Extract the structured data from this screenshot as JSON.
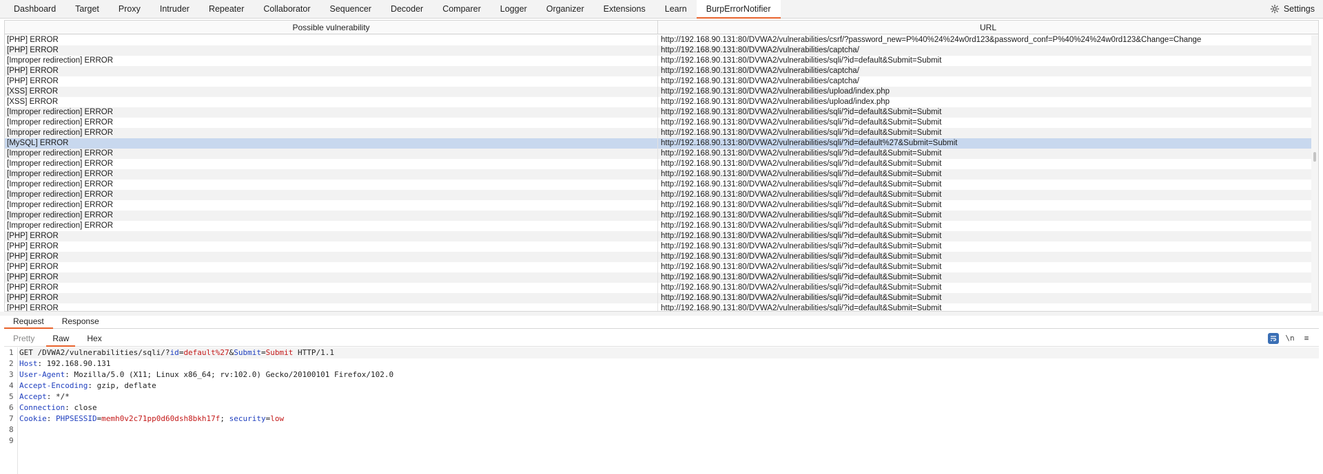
{
  "top_tabs": [
    "Dashboard",
    "Target",
    "Proxy",
    "Intruder",
    "Repeater",
    "Collaborator",
    "Sequencer",
    "Decoder",
    "Comparer",
    "Logger",
    "Organizer",
    "Extensions",
    "Learn",
    "BurpErrorNotifier"
  ],
  "active_top_tab": "BurpErrorNotifier",
  "settings_label": "Settings",
  "table": {
    "headers": [
      "Possible vulnerability",
      "URL"
    ],
    "selected_row_index": 10,
    "rows": [
      [
        "[PHP] ERROR",
        "http://192.168.90.131:80/DVWA2/vulnerabilities/csrf/?password_new=P%40%24%24w0rd123&password_conf=P%40%24%24w0rd123&Change=Change"
      ],
      [
        "[PHP] ERROR",
        "http://192.168.90.131:80/DVWA2/vulnerabilities/captcha/"
      ],
      [
        "[Improper redirection] ERROR",
        "http://192.168.90.131:80/DVWA2/vulnerabilities/sqli/?id=default&Submit=Submit"
      ],
      [
        "[PHP] ERROR",
        "http://192.168.90.131:80/DVWA2/vulnerabilities/captcha/"
      ],
      [
        "[PHP] ERROR",
        "http://192.168.90.131:80/DVWA2/vulnerabilities/captcha/"
      ],
      [
        "[XSS] ERROR",
        "http://192.168.90.131:80/DVWA2/vulnerabilities/upload/index.php"
      ],
      [
        "[XSS] ERROR",
        "http://192.168.90.131:80/DVWA2/vulnerabilities/upload/index.php"
      ],
      [
        "[Improper redirection] ERROR",
        "http://192.168.90.131:80/DVWA2/vulnerabilities/sqli/?id=default&Submit=Submit"
      ],
      [
        "[Improper redirection] ERROR",
        "http://192.168.90.131:80/DVWA2/vulnerabilities/sqli/?id=default&Submit=Submit"
      ],
      [
        "[Improper redirection] ERROR",
        "http://192.168.90.131:80/DVWA2/vulnerabilities/sqli/?id=default&Submit=Submit"
      ],
      [
        "[MySQL] ERROR",
        "http://192.168.90.131:80/DVWA2/vulnerabilities/sqli/?id=default%27&Submit=Submit"
      ],
      [
        "[Improper redirection] ERROR",
        "http://192.168.90.131:80/DVWA2/vulnerabilities/sqli/?id=default&Submit=Submit"
      ],
      [
        "[Improper redirection] ERROR",
        "http://192.168.90.131:80/DVWA2/vulnerabilities/sqli/?id=default&Submit=Submit"
      ],
      [
        "[Improper redirection] ERROR",
        "http://192.168.90.131:80/DVWA2/vulnerabilities/sqli/?id=default&Submit=Submit"
      ],
      [
        "[Improper redirection] ERROR",
        "http://192.168.90.131:80/DVWA2/vulnerabilities/sqli/?id=default&Submit=Submit"
      ],
      [
        "[Improper redirection] ERROR",
        "http://192.168.90.131:80/DVWA2/vulnerabilities/sqli/?id=default&Submit=Submit"
      ],
      [
        "[Improper redirection] ERROR",
        "http://192.168.90.131:80/DVWA2/vulnerabilities/sqli/?id=default&Submit=Submit"
      ],
      [
        "[Improper redirection] ERROR",
        "http://192.168.90.131:80/DVWA2/vulnerabilities/sqli/?id=default&Submit=Submit"
      ],
      [
        "[Improper redirection] ERROR",
        "http://192.168.90.131:80/DVWA2/vulnerabilities/sqli/?id=default&Submit=Submit"
      ],
      [
        "[PHP] ERROR",
        "http://192.168.90.131:80/DVWA2/vulnerabilities/sqli/?id=default&Submit=Submit"
      ],
      [
        "[PHP] ERROR",
        "http://192.168.90.131:80/DVWA2/vulnerabilities/sqli/?id=default&Submit=Submit"
      ],
      [
        "[PHP] ERROR",
        "http://192.168.90.131:80/DVWA2/vulnerabilities/sqli/?id=default&Submit=Submit"
      ],
      [
        "[PHP] ERROR",
        "http://192.168.90.131:80/DVWA2/vulnerabilities/sqli/?id=default&Submit=Submit"
      ],
      [
        "[PHP] ERROR",
        "http://192.168.90.131:80/DVWA2/vulnerabilities/sqli/?id=default&Submit=Submit"
      ],
      [
        "[PHP] ERROR",
        "http://192.168.90.131:80/DVWA2/vulnerabilities/sqli/?id=default&Submit=Submit"
      ],
      [
        "[PHP] ERROR",
        "http://192.168.90.131:80/DVWA2/vulnerabilities/sqli/?id=default&Submit=Submit"
      ],
      [
        "[PHP] ERROR",
        "http://192.168.90.131:80/DVWA2/vulnerabilities/sqli/?id=default&Submit=Submit"
      ]
    ]
  },
  "message_tabs": [
    "Request",
    "Response"
  ],
  "active_message_tab": "Request",
  "view_tabs": [
    "Pretty",
    "Raw",
    "Hex"
  ],
  "active_view_tab": "Raw",
  "toolbar_icons": [
    "wrap-toggle-icon",
    "newline-icon",
    "menu-icon"
  ],
  "toolbar_icon_glyphs": {
    "newline": "\\n",
    "menu": "≡"
  },
  "request": {
    "line_numbers": [
      "1",
      "2",
      "3",
      "4",
      "5",
      "6",
      "7",
      "8",
      "9"
    ],
    "request_line": {
      "method": "GET",
      "path": "/DVWA2/vulnerabilities/sqli/?",
      "param1_name": "id",
      "param1_value": "default%27",
      "amp": "&",
      "param2_name": "Submit",
      "param2_value": "Submit",
      "version": "HTTP/1.1"
    },
    "headers": [
      {
        "name": "Host",
        "value": "192.168.90.131"
      },
      {
        "name": "User-Agent",
        "value": "Mozilla/5.0 (X11; Linux x86_64; rv:102.0) Gecko/20100101 Firefox/102.0"
      },
      {
        "name": "Accept-Encoding",
        "value": "gzip, deflate"
      },
      {
        "name": "Accept",
        "value": "*/*"
      },
      {
        "name": "Connection",
        "value": "close"
      }
    ],
    "cookie": {
      "name": "Cookie",
      "c1_name": "PHPSESSID",
      "c1_value": "memh0v2c71pp0d60dsh8bkh17f",
      "c2_name": "security",
      "c2_value": "low"
    }
  },
  "colors": {
    "accent": "#e8622c",
    "selected_row": "#c8d8ee",
    "key": "#1f3fbf",
    "value": "#c41a1a"
  }
}
